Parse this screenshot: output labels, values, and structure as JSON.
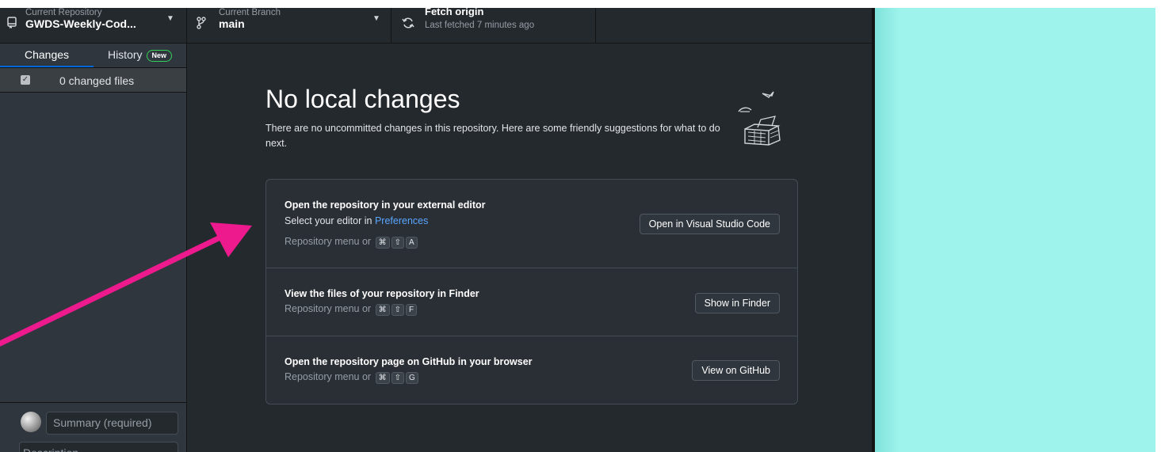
{
  "toolbar": {
    "repo": {
      "label": "Current Repository",
      "value": "GWDS-Weekly-Cod...",
      "icon": "repo-icon"
    },
    "branch": {
      "label": "Current Branch",
      "value": "main",
      "icon": "branch-icon"
    },
    "fetch": {
      "title": "Fetch origin",
      "subtitle": "Last fetched 7 minutes ago",
      "icon": "sync-icon"
    }
  },
  "sidebar": {
    "tabs": [
      {
        "label": "Changes"
      },
      {
        "label": "History",
        "badge": "New"
      }
    ],
    "changed_files": "0 changed files",
    "summary_placeholder": "Summary (required)",
    "description_placeholder": "Description"
  },
  "main": {
    "heading": "No local changes",
    "intro": "There are no uncommitted changes in this repository. Here are some friendly suggestions for what to do next.",
    "suggestions": [
      {
        "title": "Open the repository in your external editor",
        "sub_prefix": "Select your editor in ",
        "sub_link": "Preferences",
        "shortcut_prefix": "Repository menu or",
        "keys": [
          "⌘",
          "⇧",
          "A"
        ],
        "button": "Open in Visual Studio Code"
      },
      {
        "title": "View the files of your repository in Finder",
        "shortcut_prefix": "Repository menu or",
        "keys": [
          "⌘",
          "⇧",
          "F"
        ],
        "button": "Show in Finder"
      },
      {
        "title": "Open the repository page on GitHub in your browser",
        "shortcut_prefix": "Repository menu or",
        "keys": [
          "⌘",
          "⇧",
          "G"
        ],
        "button": "View on GitHub"
      }
    ]
  },
  "colors": {
    "background": "#24292e",
    "sidebar": "#2f363d",
    "accent_link": "#58a6ff",
    "annotation_arrow": "#ec1a8c",
    "outside_area": "#9ef4ed"
  }
}
